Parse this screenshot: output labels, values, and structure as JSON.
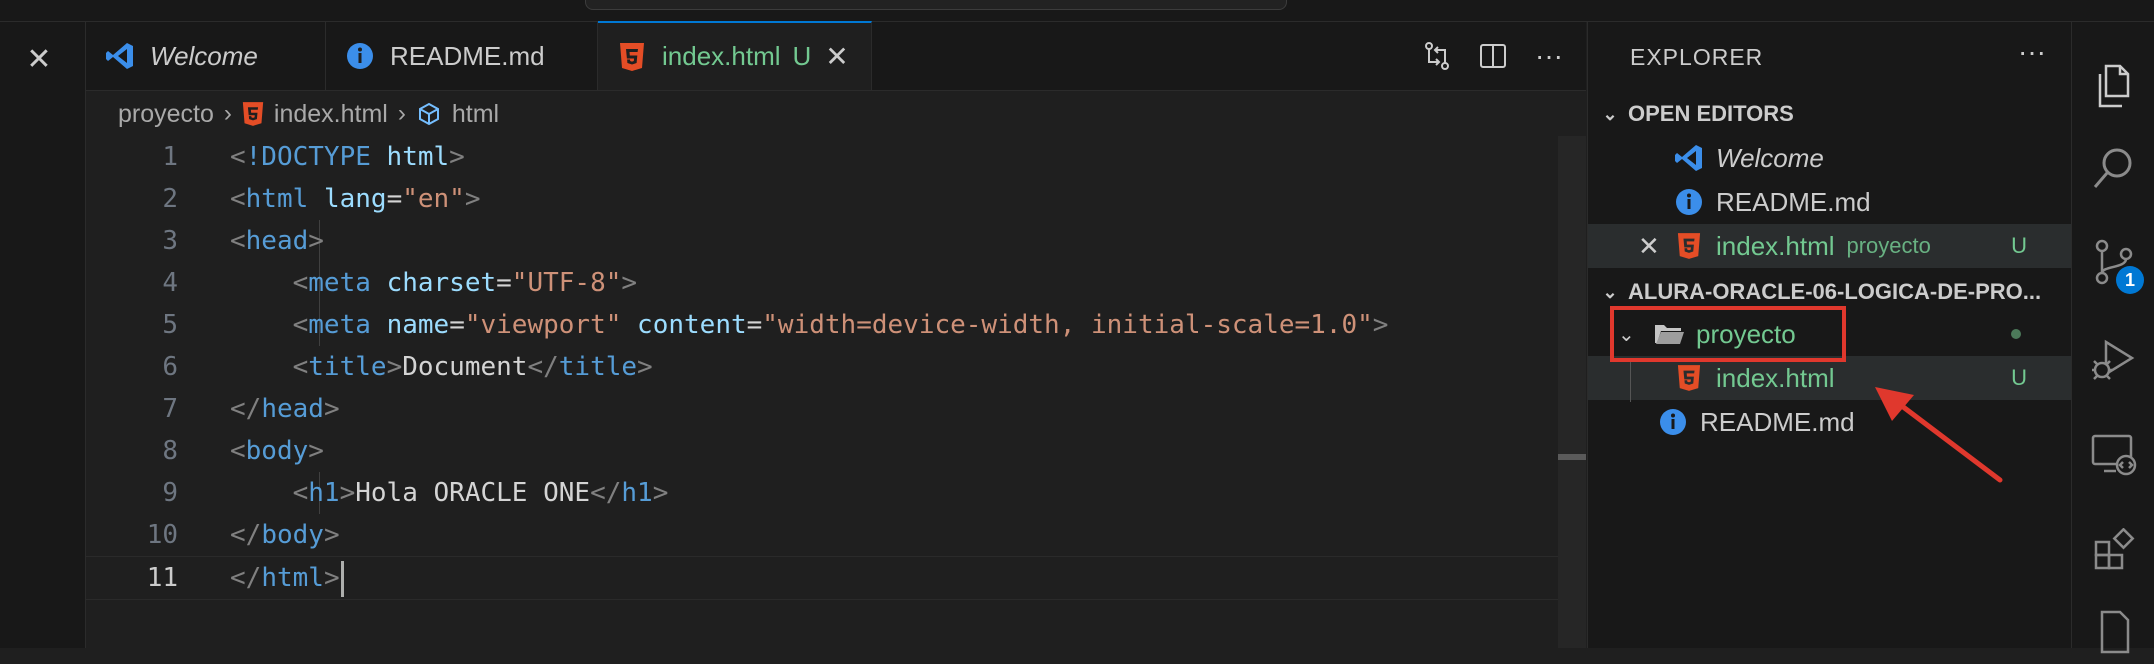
{
  "tabs": [
    {
      "label": "Welcome",
      "icon": "vscode-logo-icon",
      "italic": true
    },
    {
      "label": "README.md",
      "icon": "info-icon"
    },
    {
      "label": "index.html",
      "icon": "html5-icon",
      "status": "U",
      "active": true
    }
  ],
  "breadcrumb": {
    "folder": "proyecto",
    "file": "index.html",
    "symbol": "html"
  },
  "code_lines": [
    {
      "n": "1"
    },
    {
      "n": "2"
    },
    {
      "n": "3"
    },
    {
      "n": "4"
    },
    {
      "n": "5"
    },
    {
      "n": "6"
    },
    {
      "n": "7"
    },
    {
      "n": "8"
    },
    {
      "n": "9"
    },
    {
      "n": "10"
    },
    {
      "n": "11"
    }
  ],
  "code": {
    "doctype_kw": "!DOCTYPE",
    "doctype_val": "html",
    "html_tag": "html",
    "lang_attr": "lang",
    "lang_val": "\"en\"",
    "head_tag": "head",
    "meta_tag": "meta",
    "charset_attr": "charset",
    "charset_val": "\"UTF-8\"",
    "name_attr": "name",
    "name_val": "\"viewport\"",
    "content_attr": "content",
    "content_val": "\"width=device-width, initial-scale=1.0\"",
    "title_tag": "title",
    "title_text": "Document",
    "body_tag": "body",
    "h1_tag": "h1",
    "h1_text": "Hola ORACLE ONE"
  },
  "explorer": {
    "title": "EXPLORER",
    "open_editors_label": "OPEN EDITORS",
    "open_editors": [
      {
        "label": "Welcome"
      },
      {
        "label": "README.md"
      },
      {
        "label": "index.html",
        "desc": "proyecto",
        "status": "U"
      }
    ],
    "workspace_label": "ALURA-ORACLE-06-LOGICA-DE-PRO...",
    "tree": {
      "folder": "proyecto",
      "file_in_folder": "index.html",
      "file_in_folder_status": "U",
      "root_file": "README.md"
    }
  },
  "activity": {
    "source_control_badge": "1"
  },
  "colors": {
    "accent": "#0078d4",
    "untracked": "#73c991",
    "highlight": "#e0382d"
  }
}
